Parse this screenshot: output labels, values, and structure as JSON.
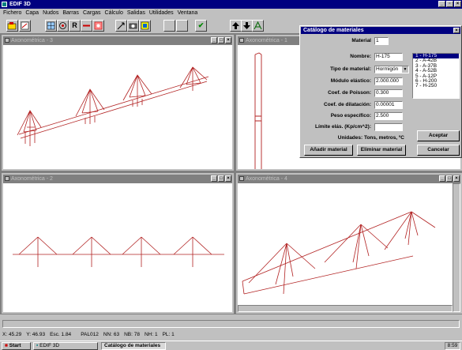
{
  "app": {
    "title": "EDIF 3D",
    "win_min": "_",
    "win_max": "▫",
    "win_close": "×"
  },
  "menu": [
    "Fichero",
    "Capa",
    "Nudos",
    "Barras",
    "Cargas",
    "Cálculo",
    "Salidas",
    "Utilidades",
    "Ventana"
  ],
  "toolbar": {
    "btn_r": "R",
    "btn_check": "✔"
  },
  "windows": [
    {
      "title": "Axonométrica - 3"
    },
    {
      "title": "Axonométrica - 1"
    },
    {
      "title": "Axonométrica - 2"
    },
    {
      "title": "Axonométrica - 4"
    }
  ],
  "dialog": {
    "title": "Catálogo de materiales",
    "close": "×",
    "material_label": "Material",
    "material_value": "1",
    "nombre_label": "Nombre:",
    "nombre_value": "H-175",
    "tipo_label": "Tipo de material:",
    "tipo_value": "Hormigón",
    "modulo_label": "Módulo elástico:",
    "modulo_value": "2.000.000",
    "poisson_label": "Coef. de Poisson:",
    "poisson_value": "0.300",
    "dilat_label": "Coef. de dilatación:",
    "dilat_value": "0.00001",
    "peso_label": "Peso específico:",
    "peso_value": "2.500",
    "limite_label": "Límite elás. (Kp/cm^2):",
    "limite_value": "",
    "unidades": "Unidades: Tons, metros, ºC",
    "aceptar": "Aceptar",
    "anadir": "Añadir material",
    "eliminar": "Eliminar material",
    "cancelar": "Cancelar",
    "list": [
      "1 - H-175",
      "2 - A-42B",
      "3 - A-37B",
      "4 - A-52B",
      "5 - A-12P",
      "6 - H-200",
      "7 - H-250"
    ]
  },
  "status": {
    "x": "X: 45.29",
    "y": "Y: 46.93",
    "esc": "Esc. 1.84",
    "pal": "PAL012",
    "nn": "NN: 63",
    "nb": "NB: 78",
    "nh": "NH: 1",
    "pl": "PL: 1"
  },
  "taskbar": {
    "start": "Start",
    "task1": "EDIF 3D",
    "task2": "Catálogo de materiales",
    "clock": "8:59"
  },
  "colors": {
    "line": "#b22222",
    "title_active": "#000080",
    "title_inactive": "#808080"
  }
}
